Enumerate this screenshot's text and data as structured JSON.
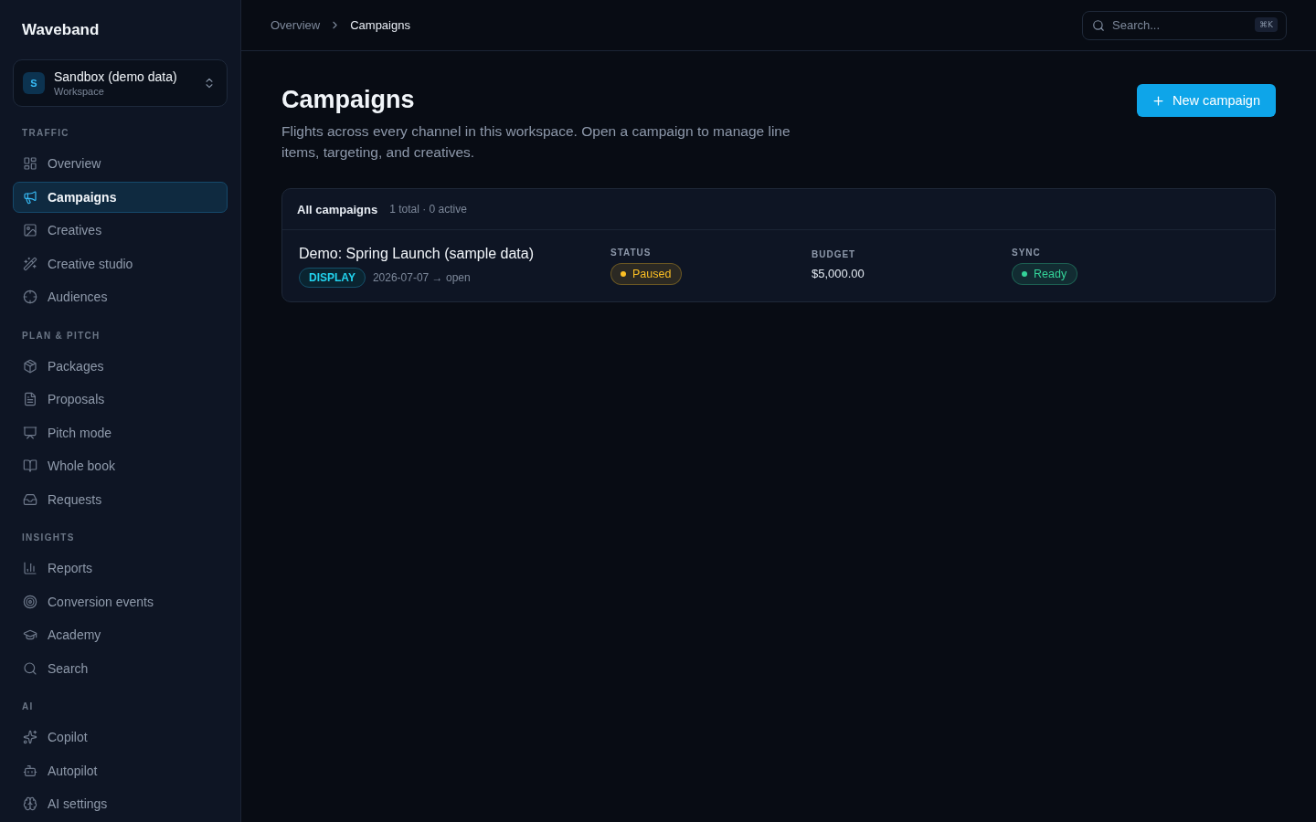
{
  "sidebar": {
    "brand": "Waveband",
    "workspace": {
      "avatar": "S",
      "name": "Sandbox (demo data)",
      "caption": "Workspace"
    },
    "sections": [
      {
        "label": "TRAFFIC",
        "items": [
          {
            "label": "Overview",
            "selected": false
          },
          {
            "label": "Campaigns",
            "selected": true
          },
          {
            "label": "Creatives",
            "selected": false
          },
          {
            "label": "Creative studio",
            "selected": false
          },
          {
            "label": "Audiences",
            "selected": false
          }
        ]
      },
      {
        "label": "PLAN & PITCH",
        "items": [
          {
            "label": "Packages",
            "selected": false
          },
          {
            "label": "Proposals",
            "selected": false
          },
          {
            "label": "Pitch mode",
            "selected": false
          },
          {
            "label": "Whole book",
            "selected": false
          },
          {
            "label": "Requests",
            "selected": false
          }
        ]
      },
      {
        "label": "INSIGHTS",
        "items": [
          {
            "label": "Reports",
            "selected": false
          },
          {
            "label": "Conversion events",
            "selected": false
          },
          {
            "label": "Academy",
            "selected": false
          },
          {
            "label": "Search",
            "selected": false
          }
        ]
      },
      {
        "label": "AI",
        "items": [
          {
            "label": "Copilot",
            "selected": false
          },
          {
            "label": "Autopilot",
            "selected": false
          },
          {
            "label": "AI settings",
            "selected": false
          }
        ]
      }
    ]
  },
  "breadcrumbs": [
    {
      "label": "Overview",
      "current": false
    },
    {
      "label": "Campaigns",
      "current": true
    }
  ],
  "search": {
    "placeholder": "Search...",
    "shortcut": "⌘K"
  },
  "page": {
    "title": "Campaigns",
    "description": "Flights across every channel in this workspace. Open a campaign to manage line items, targeting, and creatives.",
    "primary_action": "New campaign"
  },
  "campaigns_panel": {
    "title": "All campaigns",
    "summary": "1 total · 0 active",
    "rows": [
      {
        "name": "Demo: Spring Launch (sample data)",
        "channel": "DISPLAY",
        "dates": "2026-07-07 → open",
        "fields": [
          {
            "label": "STATUS",
            "kind": "badge",
            "value": "Paused",
            "color": "#fbbf24"
          },
          {
            "label": "BUDGET",
            "kind": "text",
            "value": "$5,000.00"
          },
          {
            "label": "SYNC",
            "kind": "badge",
            "value": "Ready",
            "color": "#34d399"
          }
        ]
      }
    ]
  }
}
